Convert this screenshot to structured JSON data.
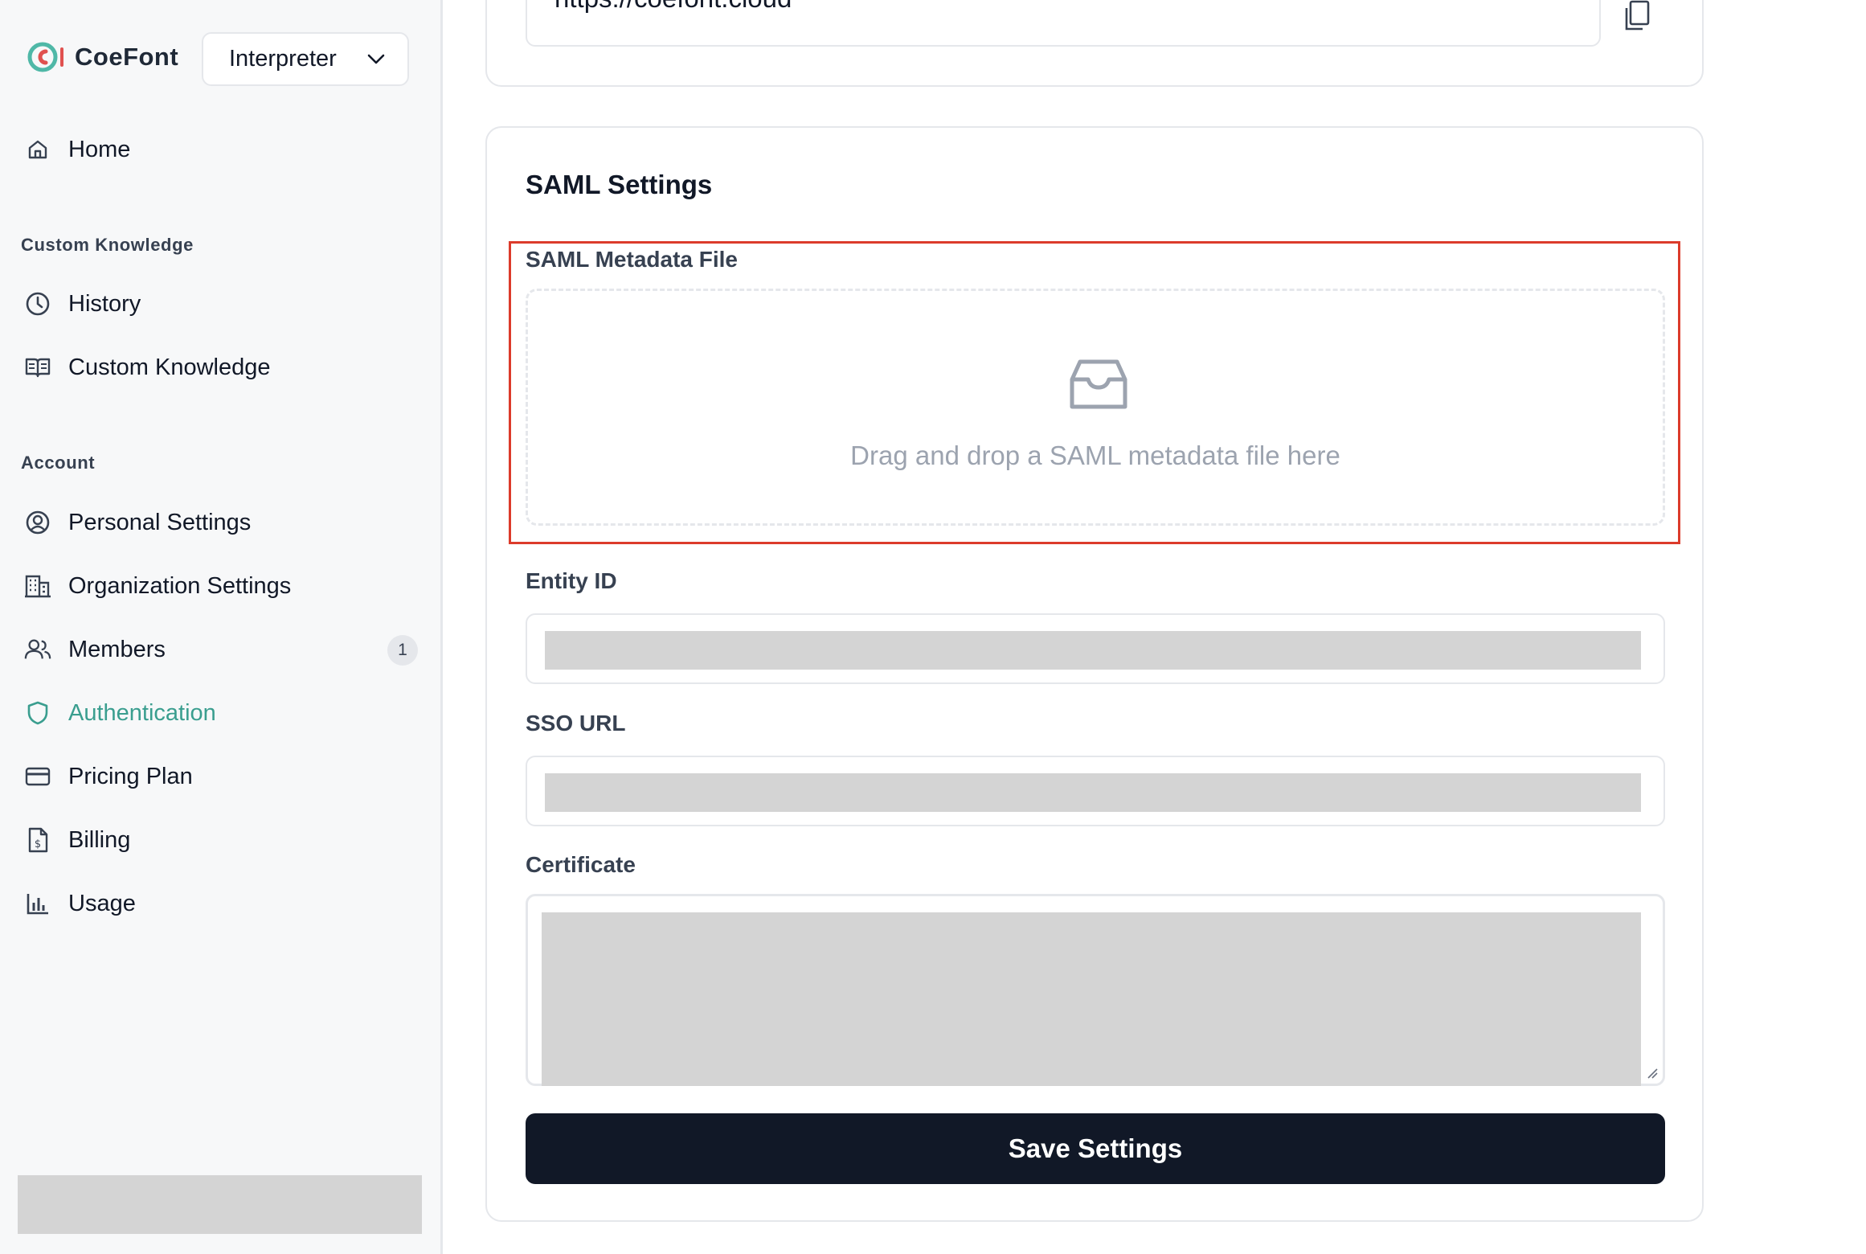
{
  "app": {
    "brand": "CoeFont",
    "workspace": "Interpreter"
  },
  "sidebar": {
    "home": "Home",
    "sections": {
      "custom_knowledge": "Custom Knowledge",
      "account": "Account"
    },
    "items": {
      "history": "History",
      "custom_knowledge": "Custom Knowledge",
      "personal_settings": "Personal Settings",
      "organization_settings": "Organization Settings",
      "members": "Members",
      "members_badge": "1",
      "authentication": "Authentication",
      "pricing_plan": "Pricing Plan",
      "billing": "Billing",
      "usage": "Usage"
    },
    "active_color": "#3a9e8f"
  },
  "main": {
    "url_value": "https://coefont.cloud",
    "saml": {
      "title": "SAML Settings",
      "metadata_label": "SAML Metadata File",
      "dropzone_hint": "Drag and drop a SAML metadata file here",
      "entity_id_label": "Entity ID",
      "sso_url_label": "SSO URL",
      "certificate_label": "Certificate",
      "save_label": "Save Settings"
    },
    "highlight_color": "#dc3b2b"
  }
}
